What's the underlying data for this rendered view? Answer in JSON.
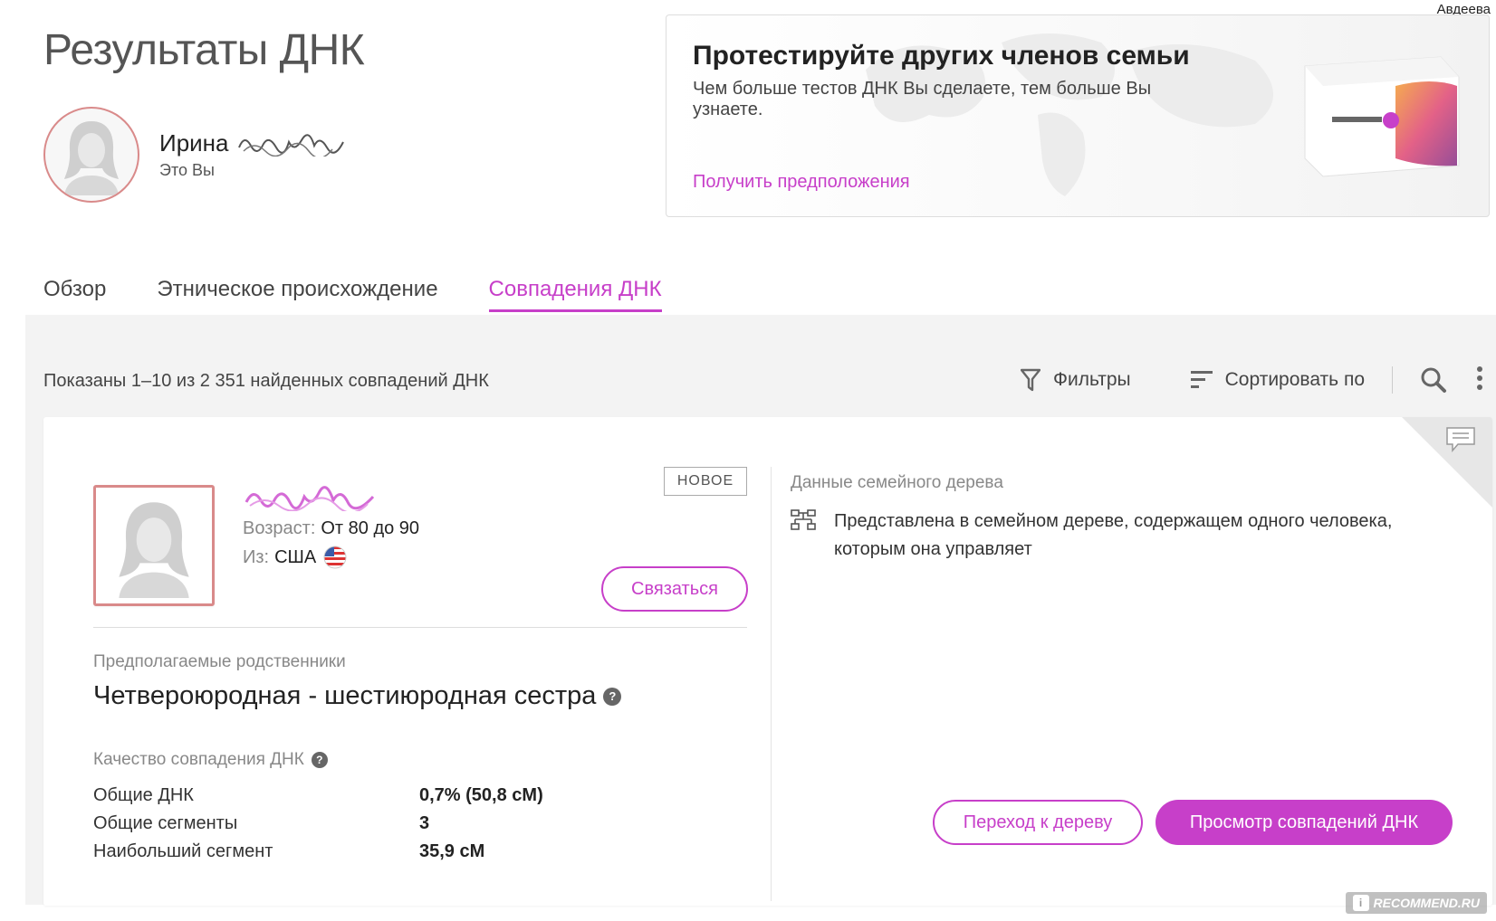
{
  "header": {
    "user_name": "Авдеева",
    "page_title": "Результаты ДНК"
  },
  "profile": {
    "name": "Ирина",
    "subtitle": "Это Вы"
  },
  "promo": {
    "title": "Протестируйте других членов семьи",
    "text": "Чем больше тестов ДНК Вы сделаете, тем больше Вы узнаете.",
    "link": "Получить предположения"
  },
  "tabs": [
    {
      "label": "Обзор",
      "active": false
    },
    {
      "label": "Этническое происхождение",
      "active": false
    },
    {
      "label": "Совпадения ДНК",
      "active": true
    }
  ],
  "toolbar": {
    "results_count": "Показаны 1–10 из 2 351 найденных совпадений ДНК",
    "filters": "Фильтры",
    "sort": "Сортировать по"
  },
  "match": {
    "badge": "НОВОЕ",
    "age_label": "Возраст:",
    "age_value": "От 80 до 90",
    "from_label": "Из:",
    "from_value": "США",
    "contact_button": "Связаться",
    "relationship_label": "Предполагаемые родственники",
    "relationship_value": "Четвероюродная - шестиюродная сестра",
    "quality_label": "Качество совпадения ДНК",
    "stats": [
      {
        "key": "Общие ДНК",
        "value": "0,7% (50,8 сМ)"
      },
      {
        "key": "Общие сегменты",
        "value": "3"
      },
      {
        "key": "Наибольший сегмент",
        "value": "35,9 сМ"
      }
    ],
    "tree_label": "Данные семейного дерева",
    "tree_text": "Представлена в семейном дереве, содержащем одного человека, которым она управляет",
    "tree_button": "Переход к дереву",
    "view_button": "Просмотр совпадений ДНК"
  },
  "watermark": "RECOMMEND.RU",
  "colors": {
    "accent": "#c73fc9",
    "avatar_border": "#d98a8a",
    "panel_bg": "#f3f3f3"
  },
  "icons": [
    "filter-icon",
    "sort-icon",
    "search-icon",
    "kebab-menu-icon",
    "chat-icon",
    "family-tree-icon",
    "help-icon",
    "us-flag-icon"
  ]
}
